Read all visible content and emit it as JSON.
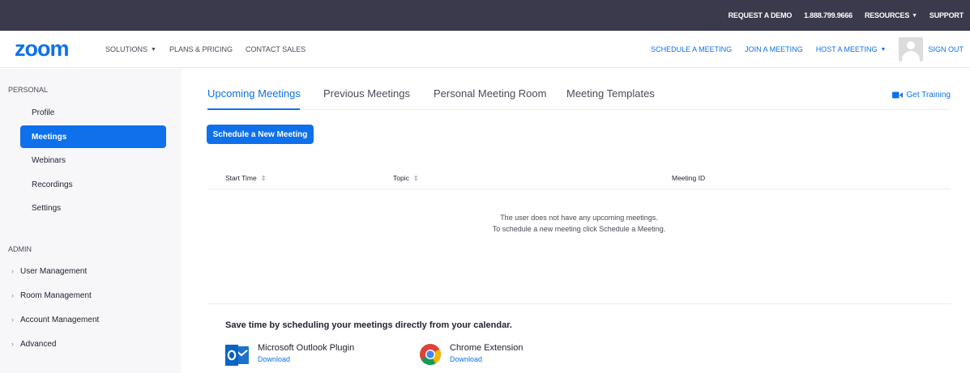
{
  "topbar": {
    "request_demo": "REQUEST A DEMO",
    "phone": "1.888.799.9666",
    "resources": "RESOURCES",
    "support": "SUPPORT"
  },
  "nav": {
    "logo": "zoom",
    "solutions": "SOLUTIONS",
    "plans": "PLANS & PRICING",
    "contact": "CONTACT SALES",
    "schedule": "SCHEDULE A MEETING",
    "join": "JOIN A MEETING",
    "host": "HOST A MEETING",
    "signout": "SIGN OUT"
  },
  "sidebar": {
    "personal_label": "PERSONAL",
    "personal_items": [
      "Profile",
      "Meetings",
      "Webinars",
      "Recordings",
      "Settings"
    ],
    "active_item": "Meetings",
    "admin_label": "ADMIN",
    "admin_items": [
      "User Management",
      "Room Management",
      "Account Management",
      "Advanced"
    ]
  },
  "tabs": {
    "upcoming": "Upcoming Meetings",
    "previous": "Previous Meetings",
    "pmr": "Personal Meeting Room",
    "templates": "Meeting Templates"
  },
  "get_training": "Get Training",
  "schedule_new": "Schedule a New Meeting",
  "table": {
    "start_time": "Start Time",
    "topic": "Topic",
    "meeting_id": "Meeting ID",
    "empty_line1": "The user does not have any upcoming meetings.",
    "empty_line2": "To schedule a new meeting click Schedule a Meeting."
  },
  "calendar": {
    "title": "Save time by scheduling your meetings directly from your calendar.",
    "outlook_name": "Microsoft Outlook Plugin",
    "outlook_link": "Download",
    "chrome_name": "Chrome Extension",
    "chrome_link": "Download"
  },
  "colors": {
    "brand_blue": "#0e71eb",
    "topbar_bg": "#3a3a4c",
    "sidebar_bg": "#f7f7fa"
  }
}
